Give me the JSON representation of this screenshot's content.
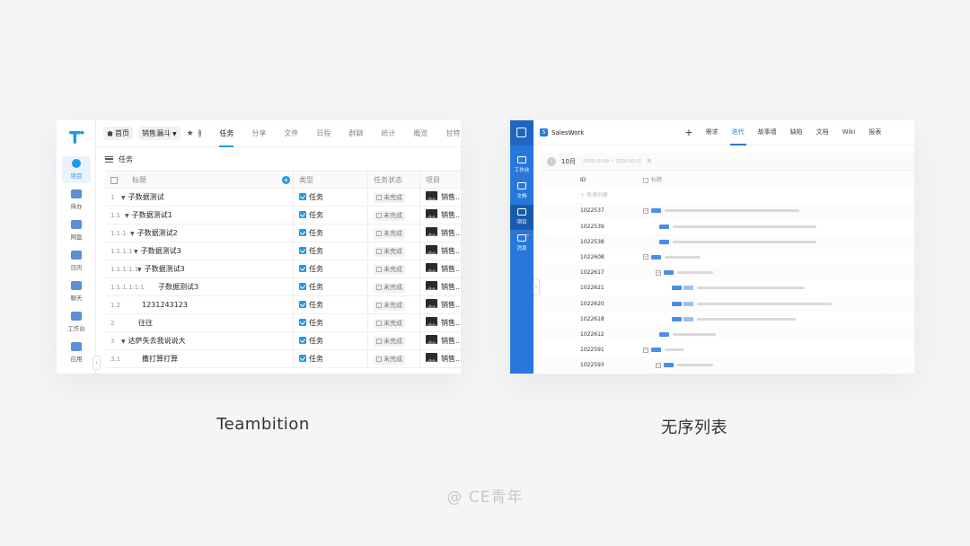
{
  "captions": {
    "left": "Teambition",
    "right": "无序列表"
  },
  "watermark": "@ CE青年",
  "teambition": {
    "sidebar": [
      "项目",
      "待办",
      "网盘",
      "日历",
      "聊天",
      "工作台",
      "应用"
    ],
    "crumb": {
      "home": "首页",
      "project": "销售漏斗"
    },
    "tabs": [
      "任务",
      "分享",
      "文件",
      "日程",
      "群聊",
      "统计",
      "概览",
      "甘特图"
    ],
    "view_title": "任务",
    "columns": {
      "title": "标题",
      "type": "类型",
      "status": "任务状态",
      "project": "项目"
    },
    "rows": [
      {
        "num": "1",
        "title": "子数据测试",
        "indent": 18,
        "arrow": true
      },
      {
        "num": "1.1",
        "title": "子数据测试1",
        "indent": 22,
        "arrow": true
      },
      {
        "num": "1.1.1",
        "title": "子数据测试2",
        "indent": 28,
        "arrow": true
      },
      {
        "num": "1.1.1.1",
        "title": "子数据测试3",
        "indent": 32,
        "arrow": true
      },
      {
        "num": "1.1.1.1.1",
        "title": "子数据测试3",
        "indent": 36,
        "arrow": true
      },
      {
        "num": "1.1.1.1.1.1",
        "title": "子数据测试3",
        "indent": 50,
        "arrow": false
      },
      {
        "num": "1.2",
        "title": "1231243123",
        "indent": 32,
        "arrow": false
      },
      {
        "num": "2",
        "title": "往往",
        "indent": 28,
        "arrow": false
      },
      {
        "num": "3",
        "title": "达萨失去我说说大",
        "indent": 18,
        "arrow": true
      },
      {
        "num": "3.1",
        "title": "撒打算打算",
        "indent": 32,
        "arrow": false
      }
    ],
    "type_label": "任务",
    "status_label": "未完成",
    "project_label": "销售..."
  },
  "saleswork": {
    "brand": "SalesWork",
    "brand_icon": "S",
    "plus": "+",
    "sidebar": [
      {
        "label": "工作台"
      },
      {
        "label": "文档"
      },
      {
        "label": "项目"
      },
      {
        "label": "消息"
      }
    ],
    "tabs": [
      "需求",
      "迭代",
      "故事墙",
      "缺陷",
      "文档",
      "Wiki",
      "报表"
    ],
    "month": "10月",
    "range": "2020-10-09 ~ 2020-10-31",
    "more": "席",
    "col_id": "ID",
    "col_title": "标题",
    "new_row": "+ 快速创建",
    "ids": [
      "1022537",
      "1022539",
      "1022538",
      "1022608",
      "1022617",
      "1022621",
      "1022620",
      "1022618",
      "1022612",
      "1022591",
      "1022593"
    ]
  }
}
